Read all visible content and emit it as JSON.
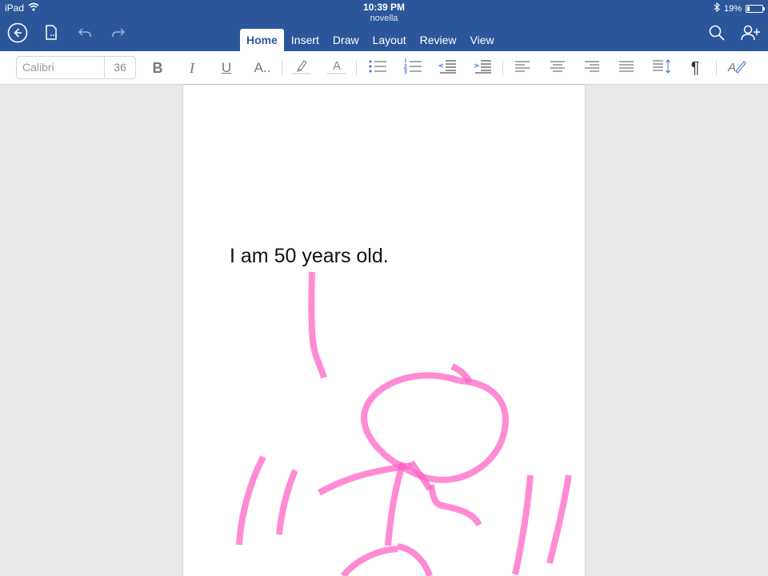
{
  "status": {
    "device": "iPad",
    "time": "10:39 PM",
    "battery": "19%",
    "battery_level": 0.19
  },
  "document": {
    "name": "novella",
    "text": "I am 50 years old."
  },
  "tabs": [
    "Home",
    "Insert",
    "Draw",
    "Layout",
    "Review",
    "View"
  ],
  "active_tab": "Home",
  "ribbon": {
    "font_name": "Calibri",
    "font_size": "36",
    "bold": "B",
    "italic": "I",
    "underline": "U",
    "more_text": "A..",
    "font_color": "A",
    "styles": "A",
    "paragraph_mark": "¶"
  },
  "colors": {
    "accent": "#2b579a",
    "ink": "#ff5ec4"
  }
}
